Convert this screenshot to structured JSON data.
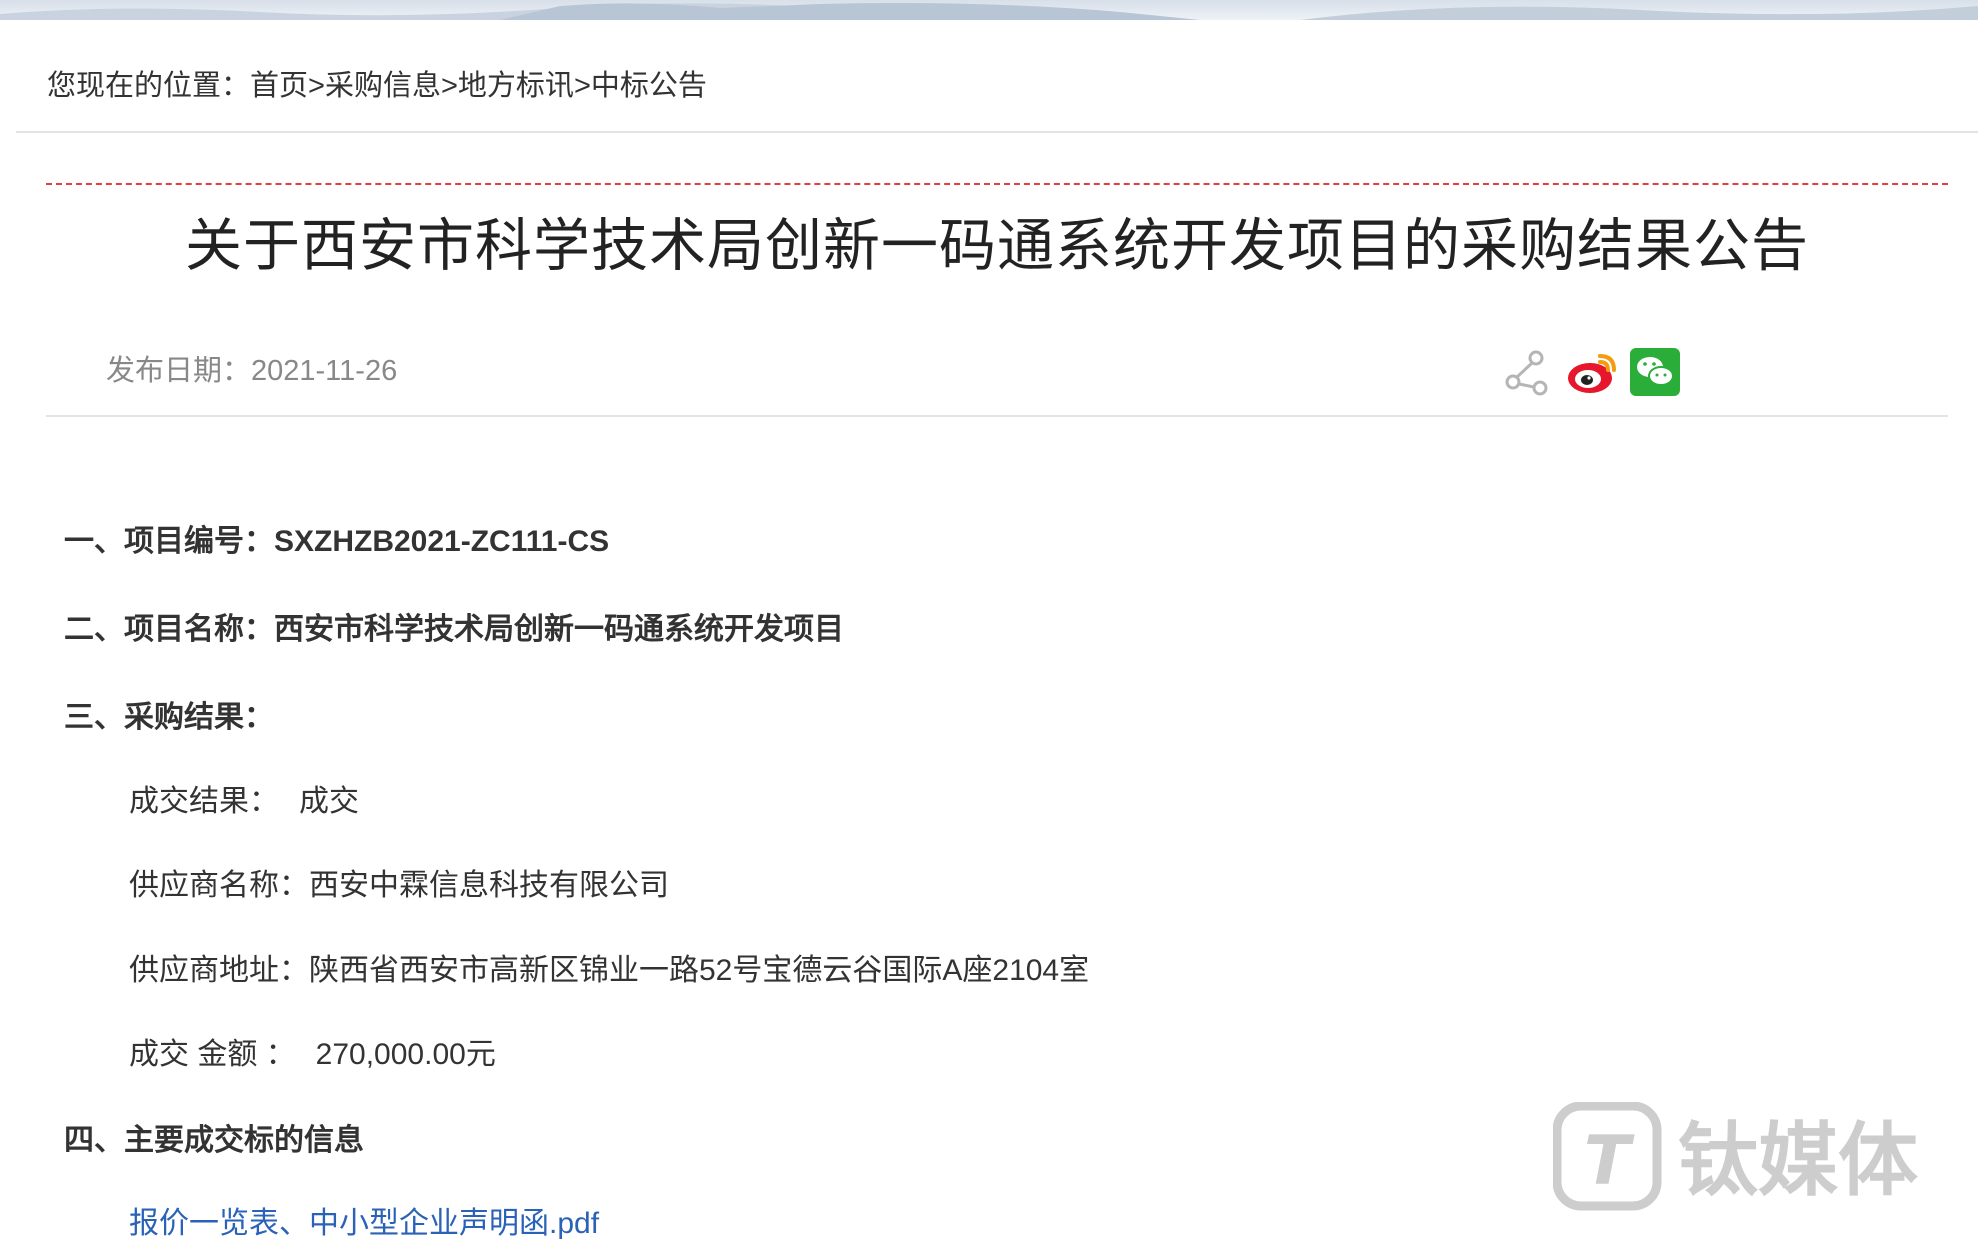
{
  "breadcrumb": {
    "prefix": "您现在的位置：",
    "items": [
      "首页",
      "采购信息",
      "地方标讯",
      "中标公告"
    ],
    "separator": ">"
  },
  "article": {
    "title": "关于西安市科学技术局创新一码通系统开发项目的采购结果公告",
    "pub_date_label": "发布日期：",
    "pub_date": "2021-11-26"
  },
  "share": {
    "icons": [
      "share-link-icon",
      "weibo-icon",
      "wechat-icon"
    ],
    "weibo_color": "#e6162d",
    "wechat_color": "#2bad3a"
  },
  "content": {
    "section1": {
      "label": "一、项目编号：",
      "value": "SXZHZB2021-ZC111-CS"
    },
    "section2": {
      "label": "二、项目名称：",
      "value": "西安市科学技术局创新一码通系统开发项目"
    },
    "section3": {
      "label": "三、采购结果：",
      "result_label": "成交结果：",
      "result_value": "成交",
      "supplier_name_label": "供应商名称：",
      "supplier_name": "西安中霖信息科技有限公司",
      "supplier_address_label": "供应商地址：",
      "supplier_address": "陕西省西安市高新区锦业一路52号宝德云谷国际A座2104室",
      "amount_label": "成交 金额 ：",
      "amount_value": "270,000.00元"
    },
    "section4": {
      "label": "四、主要成交标的信息",
      "attachment": "报价一览表、中小型企业声明函.pdf"
    }
  },
  "watermark": {
    "text": "钛媒体",
    "logo_letter": "T"
  },
  "colors": {
    "link": "#2a62b8",
    "dashed_rule": "#e24040"
  }
}
